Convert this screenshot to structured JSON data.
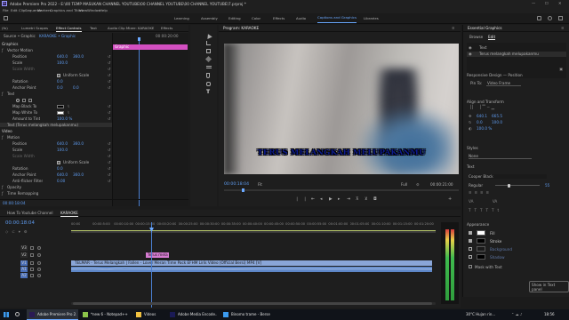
{
  "titlebar": {
    "app_title": "Adobe Premiere Pro 2022 - E:\\00 TEMP MASUKAN CHANNEL YOUTUBE\\00 CHANNEL YOUTUBE\\00 CHANNEL YOUTUBE\\7.prproj *",
    "min": "—",
    "max": "☐",
    "close": "✕"
  },
  "menubar": [
    "File",
    "Edit",
    "Clip",
    "Sequence",
    "Markers",
    "Graphics and Titles",
    "View",
    "Window",
    "Help"
  ],
  "workspaces": [
    "Learning",
    "Assembly",
    "Editing",
    "Color",
    "Effects",
    "Audio",
    "Captions and Graphics",
    "Libraries"
  ],
  "active_workspace_index": 6,
  "source_tabs": [
    "(fx)",
    "Lumetri Scopes",
    "Effect Controls",
    "Text",
    "Audio Clip Mixer: KARAOKE",
    "Effects"
  ],
  "effect_controls": {
    "source_line": "Source • Graphic",
    "seq_line": "KARAOKE • Graphic",
    "time": "00:00:20:00",
    "clip_label": "Graphic",
    "rows": [
      {
        "label": "Graphics",
        "indent": 0
      },
      {
        "label": "Vector Motion",
        "indent": 1,
        "fx": true
      },
      {
        "label": "Position",
        "v1": "640.0",
        "v2": "360.0",
        "indent": 2
      },
      {
        "label": "Scale",
        "v1": "100.0",
        "indent": 2
      },
      {
        "label": "Scale Width",
        "v1": "",
        "indent": 2,
        "dim": true
      },
      {
        "label": "Uniform Scale",
        "check": true,
        "indent": 2
      },
      {
        "label": "Rotation",
        "v1": "0.0",
        "indent": 2
      },
      {
        "label": "Anchor Point",
        "v1": "0.0",
        "v2": "0.0",
        "indent": 2
      },
      {
        "label": "Text",
        "indent": 1,
        "fx": true
      },
      {
        "label": "",
        "indent": 2,
        "shapes": true
      },
      {
        "label": "Map Black To",
        "indent": 2
      },
      {
        "label": "Map White To",
        "indent": 2
      },
      {
        "label": "Amount to Tint",
        "v1": "100.0 %",
        "indent": 2
      },
      {
        "label": "Text (Terus melangkah melupakanmu)",
        "indent": 1,
        "sel": true
      },
      {
        "label": "Video",
        "indent": 0
      },
      {
        "label": "Motion",
        "indent": 1,
        "fx": true
      },
      {
        "label": "Position",
        "v1": "640.0",
        "v2": "360.0",
        "indent": 2
      },
      {
        "label": "Scale",
        "v1": "100.0",
        "indent": 2
      },
      {
        "label": "Scale Width",
        "v1": "",
        "indent": 2,
        "dim": true
      },
      {
        "label": "Uniform Scale",
        "check": true,
        "indent": 2
      },
      {
        "label": "Rotation",
        "v1": "0.0",
        "indent": 2
      },
      {
        "label": "Anchor Point",
        "v1": "640.0",
        "v2": "360.0",
        "indent": 2
      },
      {
        "label": "Anti-flicker Filter",
        "v1": "0.00",
        "indent": 2
      },
      {
        "label": "Opacity",
        "indent": 1,
        "fx": true
      },
      {
        "label": "Time Remapping",
        "indent": 1,
        "fx": true
      }
    ],
    "footer_time": "00:00:18:04"
  },
  "program": {
    "tab": "Program: KARAOKE",
    "caption": "TERUS MELANGKAH MELUPAKANMU",
    "timecode": "00:00:18:04",
    "fit": "Fit",
    "quality": "Full",
    "duration": "00:00:21:00"
  },
  "essential_graphics": {
    "tab": "Essential Graphics",
    "subtabs": [
      "Browse",
      "Edit"
    ],
    "layers": [
      "Text",
      "Terus melangkah melupakanmu"
    ],
    "responsive_label": "Responsive Design — Position",
    "pin_to_label": "Pin To:",
    "pin_to_value": "Video Frame",
    "align_title": "Align and Transform",
    "pos_x": "640.1",
    "pos_y": "665.5",
    "rot_val": "0.0",
    "scale_val": "100.0",
    "opacity_val": "100.0 %",
    "styles_title": "Styles",
    "styles_value": "None",
    "text_title": "Text",
    "font": "Cooper Black",
    "font_style": "Regular",
    "font_size": "55",
    "appearance_title": "Appearance",
    "appearance": [
      {
        "label": "Fill",
        "color": "#ffffff",
        "checked": true
      },
      {
        "label": "Stroke",
        "color": "#000000",
        "checked": true
      },
      {
        "label": "Background",
        "color": "#1a1a1a",
        "checked": false
      },
      {
        "label": "Shadow",
        "color": "#000000",
        "checked": false
      }
    ],
    "mask_label": "Mask with Text",
    "show_text_panel": "Show in Text panel"
  },
  "timeline": {
    "tabs": [
      "How To Youtube Channel",
      "KARAOKE"
    ],
    "active_tab_index": 1,
    "timecode": "00:00:18:04",
    "ruler": [
      "00:00",
      "00:00:5:00",
      "00:00:10:00",
      "00:00:15:00",
      "00:00:20:00",
      "00:00:25:00",
      "00:00:30:00",
      "00:00:35:00",
      "00:00:40:00",
      "00:00:45:00",
      "00:00:50:00",
      "00:00:55:00",
      "00:01:00:00",
      "00:01:05:00",
      "00:01:10:00",
      "00:01:15:00",
      "00:01:20:00"
    ],
    "tracks": [
      "V3",
      "V2",
      "V1",
      "A1",
      "A2"
    ],
    "graphic_clip": "Terus mela",
    "video_clip": "TELMAR - Terus Melangkah | Fallen - Lover Meran Time Pack EFHM Lirik Video (Official Bersi) MP4 [V]",
    "audio_clip": ""
  },
  "taskbar": {
    "items": [
      "Adobe Premiere Pro 2...",
      "*new 6 - Notepad++",
      "Videos",
      "Adobe Media Encode...",
      "Binomo trame - Berset..."
    ],
    "weather": "30°C  Hujan rin...",
    "clock": "18:56"
  }
}
